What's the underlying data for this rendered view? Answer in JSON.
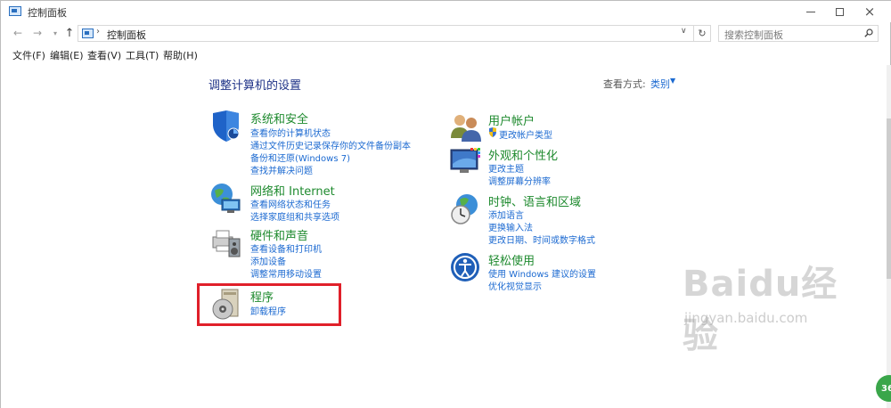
{
  "window": {
    "title": "控制面板",
    "minimize": "minimize",
    "maximize": "maximize",
    "close": "×"
  },
  "nav": {
    "back": "←",
    "forward": "→",
    "recent": "▾",
    "up": "↑",
    "address_sep": "›",
    "address": "控制面板",
    "address_dropdown": "∨",
    "refresh": "↻",
    "search_placeholder": "搜索控制面板"
  },
  "menu": [
    "文件(F)",
    "编辑(E)",
    "查看(V)",
    "工具(T)",
    "帮助(H)"
  ],
  "main": {
    "title": "调整计算机的设置",
    "view_label": "查看方式:",
    "view_value": "类别",
    "view_caret": "▼"
  },
  "categories_left": [
    {
      "title": "系统和安全",
      "icon": "shield-icon",
      "links": [
        "查看你的计算机状态",
        "通过文件历史记录保存你的文件备份副本",
        "备份和还原(Windows 7)",
        "查找并解决问题"
      ]
    },
    {
      "title": "网络和 Internet",
      "icon": "network-globe-icon",
      "links": [
        "查看网络状态和任务",
        "选择家庭组和共享选项"
      ]
    },
    {
      "title": "硬件和声音",
      "icon": "printer-speaker-icon",
      "links": [
        "查看设备和打印机",
        "添加设备",
        "调整常用移动设置"
      ]
    },
    {
      "title": "程序",
      "icon": "programs-disc-icon",
      "links": [
        "卸载程序"
      ]
    }
  ],
  "categories_right": [
    {
      "title": "用户帐户",
      "icon": "users-icon",
      "links": [
        "更改帐户类型"
      ]
    },
    {
      "title": "外观和个性化",
      "icon": "monitor-palette-icon",
      "links": [
        "更改主题",
        "调整屏幕分辨率"
      ]
    },
    {
      "title": "时钟、语言和区域",
      "icon": "clock-globe-icon",
      "links": [
        "添加语言",
        "更换输入法",
        "更改日期、时间或数字格式"
      ]
    },
    {
      "title": "轻松使用",
      "icon": "ease-of-access-icon",
      "links": [
        "使用 Windows 建议的设置",
        "优化视觉显示"
      ]
    }
  ],
  "watermark": {
    "main": "Baidu经验",
    "sub": "jingyan.baidu.com"
  },
  "badge": "36",
  "colors": {
    "category_title": "#1e8a2e",
    "link": "#1c6ad1",
    "page_title": "#1e3287",
    "highlight": "#e0202a"
  }
}
